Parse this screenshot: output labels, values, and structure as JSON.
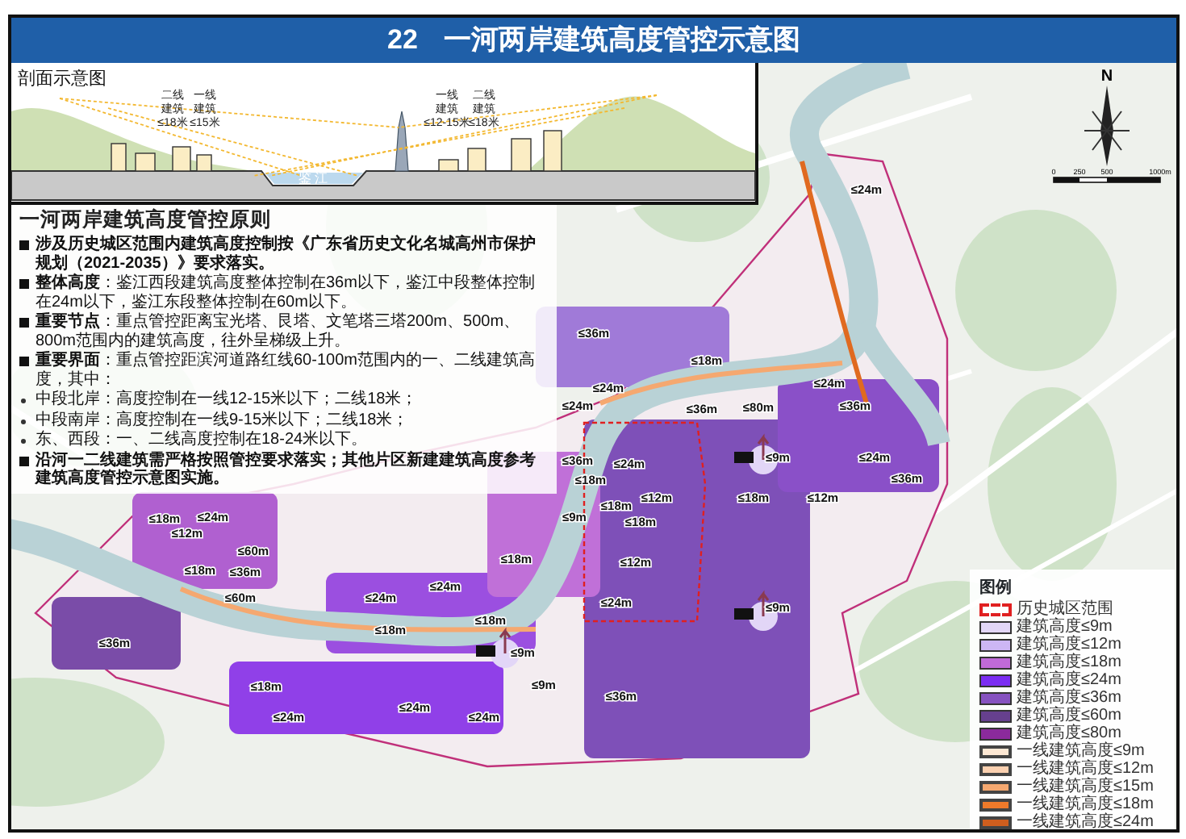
{
  "title": {
    "number": "22",
    "text": "一河两岸建筑高度管控示意图"
  },
  "section": {
    "title": "剖面示意图",
    "river": "鉴 江",
    "labels": [
      {
        "lines": [
          "二线",
          "建筑",
          "≤18米"
        ]
      },
      {
        "lines": [
          "一线",
          "建筑",
          "≤15米"
        ]
      },
      {
        "lines": [
          "一线",
          "建筑",
          "≤12-15米"
        ]
      },
      {
        "lines": [
          "二线",
          "建筑",
          "≤18米"
        ]
      }
    ]
  },
  "principles": {
    "heading": "一河两岸建筑高度管控原则",
    "items": [
      {
        "kind": "main",
        "text": "**涉及历史城区范围内建筑高度控制按《广东省历史文化名城高州市保护规划（2021-2035）》要求落实。**"
      },
      {
        "kind": "main",
        "text": "**整体高度**：鉴江西段建筑高度整体控制在36m以下，鉴江中段整体控制在24m以下，鉴江东段整体控制在60m以下。"
      },
      {
        "kind": "main",
        "text": "**重要节点**：重点管控距离宝光塔、艮塔、文笔塔三塔200m、500m、800m范围内的建筑高度，往外呈梯级上升。"
      },
      {
        "kind": "main",
        "text": "**重要界面**：重点管控距滨河道路红线60-100m范围内的一、二线建筑高度，其中："
      },
      {
        "kind": "sub",
        "text": "中段北岸：高度控制在一线12-15米以下；二线18米；"
      },
      {
        "kind": "sub",
        "text": "中段南岸：高度控制在一线9-15米以下；二线18米；"
      },
      {
        "kind": "sub",
        "text": "东、西段：一、二线高度控制在18-24米以下。"
      },
      {
        "kind": "main",
        "text": "**沿河一二线建筑需严格按照管控要求落实；其他片区新建建筑高度参考建筑高度管控示意图实施。**"
      }
    ]
  },
  "compass": {
    "north": "N",
    "scale": [
      "0",
      "250",
      "500",
      "1000m"
    ]
  },
  "map_labels": [
    {
      "text": "≤24m"
    },
    {
      "text": "≤36m"
    },
    {
      "text": "≤18m"
    },
    {
      "text": "≤24m"
    },
    {
      "text": "≤24m"
    },
    {
      "text": "≤24m"
    },
    {
      "text": "≤36m"
    },
    {
      "text": "≤80m"
    },
    {
      "text": "≤36m"
    },
    {
      "text": "≤36m"
    },
    {
      "text": "≤24m"
    },
    {
      "text": "≤9m"
    },
    {
      "text": "≤24m"
    },
    {
      "text": "≤18m"
    },
    {
      "text": "≤36m"
    },
    {
      "text": "≤12m"
    },
    {
      "text": "≤18m"
    },
    {
      "text": "≤12m"
    },
    {
      "text": "≤18m"
    },
    {
      "text": "≤24m"
    },
    {
      "text": "≤9m"
    },
    {
      "text": "≤18m"
    },
    {
      "text": "≤12m"
    },
    {
      "text": "≤18m"
    },
    {
      "text": "≤60m"
    },
    {
      "text": "≤18m"
    },
    {
      "text": "≤12m"
    },
    {
      "text": "≤18m"
    },
    {
      "text": "≤36m"
    },
    {
      "text": "≤60m"
    },
    {
      "text": "≤24m"
    },
    {
      "text": "≤24m"
    },
    {
      "text": "≤24m"
    },
    {
      "text": "≤9m"
    },
    {
      "text": "≤36m"
    },
    {
      "text": "≤18m"
    },
    {
      "text": "≤18m"
    },
    {
      "text": "≤9m"
    },
    {
      "text": "≤18m"
    },
    {
      "text": "≤9m"
    },
    {
      "text": "≤36m"
    },
    {
      "text": "≤24m"
    },
    {
      "text": "≤24m"
    },
    {
      "text": "≤24m"
    }
  ],
  "legend": {
    "title": "图例",
    "items": [
      {
        "kind": "boundary",
        "label": "历史城区范围",
        "color": "#e02020"
      },
      {
        "kind": "zone",
        "label": "建筑高度≤9m",
        "color": "#e2d6f7"
      },
      {
        "kind": "zone",
        "label": "建筑高度≤12m",
        "color": "#cdb6f4"
      },
      {
        "kind": "zone",
        "label": "建筑高度≤18m",
        "color": "#c06ad8"
      },
      {
        "kind": "zone",
        "label": "建筑高度≤24m",
        "color": "#7b2df2"
      },
      {
        "kind": "zone",
        "label": "建筑高度≤36m",
        "color": "#8652c0"
      },
      {
        "kind": "zone",
        "label": "建筑高度≤60m",
        "color": "#66408e"
      },
      {
        "kind": "zone",
        "label": "建筑高度≤80m",
        "color": "#8b2a9c"
      },
      {
        "kind": "frontline",
        "label": "一线建筑高度≤9m",
        "color": "#fde8d4"
      },
      {
        "kind": "frontline",
        "label": "一线建筑高度≤12m",
        "color": "#fbd0b0"
      },
      {
        "kind": "frontline",
        "label": "一线建筑高度≤15m",
        "color": "#f5a870"
      },
      {
        "kind": "frontline",
        "label": "一线建筑高度≤18m",
        "color": "#ef7a2a"
      },
      {
        "kind": "frontline",
        "label": "一线建筑高度≤24m",
        "color": "#cf5e1e"
      }
    ]
  }
}
